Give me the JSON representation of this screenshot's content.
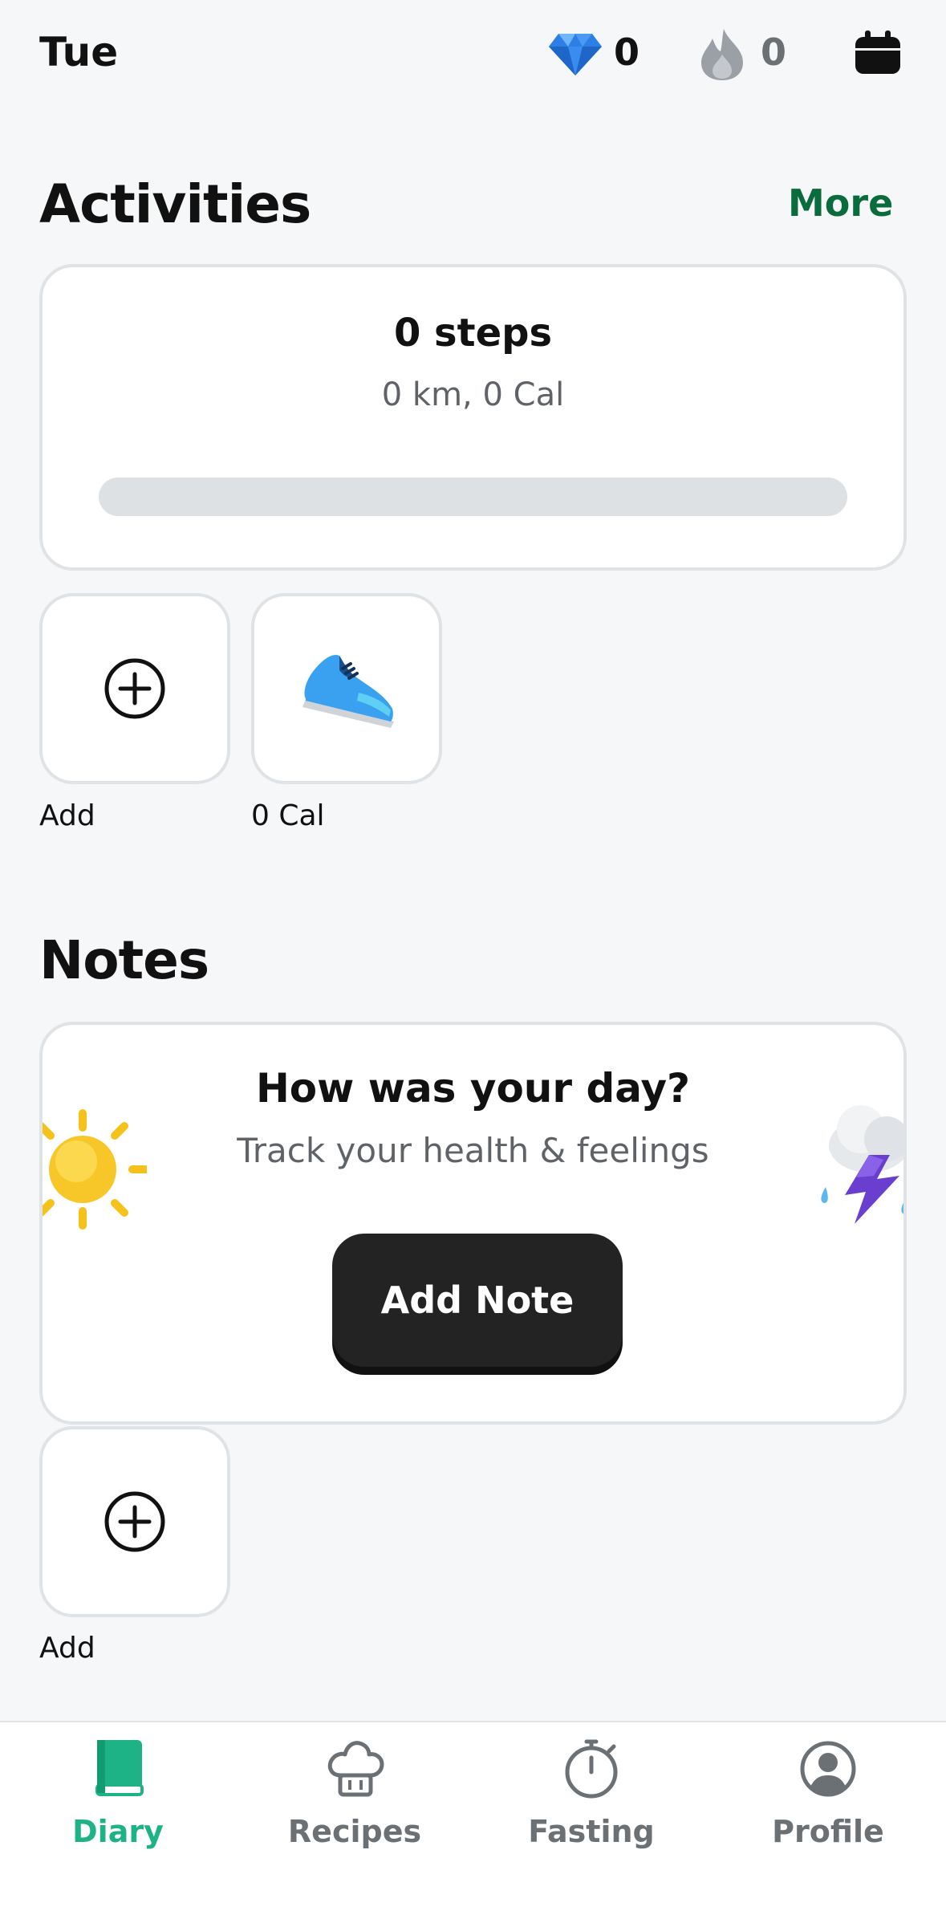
{
  "header": {
    "day": "Tue",
    "gems": "0",
    "streak": "0"
  },
  "activities": {
    "title": "Activities",
    "more_label": "More",
    "steps_title": "0 steps",
    "steps_subtitle": "0 km, 0 Cal",
    "steps_progress": 0,
    "tiles": [
      {
        "label": "Add",
        "icon": "plus-circle-icon"
      },
      {
        "label": "0 Cal",
        "icon": "sneaker-icon"
      }
    ]
  },
  "notes": {
    "title": "Notes",
    "prompt_title": "How was your day?",
    "prompt_subtitle": "Track your health & feelings",
    "add_note_label": "Add Note",
    "tiles": [
      {
        "label": "Add",
        "icon": "plus-circle-icon"
      }
    ]
  },
  "bottom_nav": {
    "items": [
      {
        "label": "Diary",
        "icon": "book-icon",
        "active": true
      },
      {
        "label": "Recipes",
        "icon": "chef-hat-icon",
        "active": false
      },
      {
        "label": "Fasting",
        "icon": "stopwatch-icon",
        "active": false
      },
      {
        "label": "Profile",
        "icon": "user-circle-icon",
        "active": false
      }
    ]
  },
  "colors": {
    "accent": "#1db386",
    "more_link": "#0a6b3c",
    "background": "#f6f7f9",
    "button_dark": "#232323"
  }
}
